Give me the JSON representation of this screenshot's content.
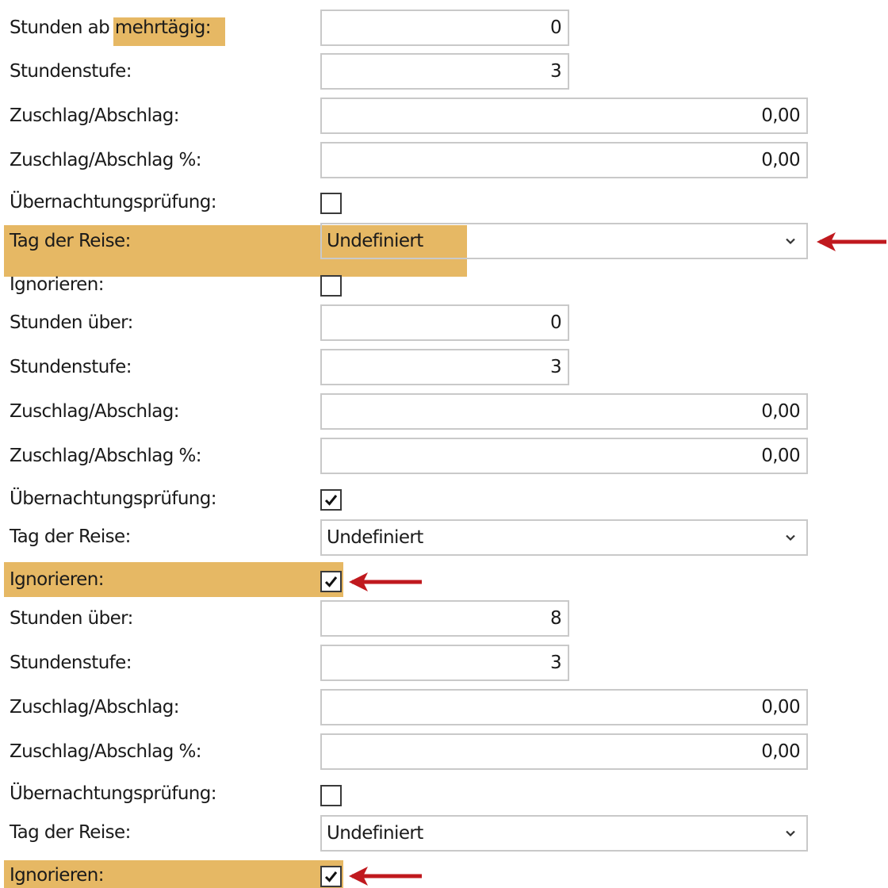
{
  "groups": [
    {
      "first_label_prefix": "Stunden ab",
      "first_label_highlight": "mehrtägig:",
      "first_value": "0",
      "stufe_label": "Stundenstufe:",
      "stufe_value": "3",
      "zuschlag_label": "Zuschlag/Abschlag:",
      "zuschlag_value": "0,00",
      "zuschlag_pct_label": "Zuschlag/Abschlag %:",
      "zuschlag_pct_value": "0,00",
      "uebernachtung_label": "Übernachtungsprüfung:",
      "uebernachtung_checked": false,
      "tag_label": "Tag der Reise:",
      "tag_value": "Undefiniert",
      "ignorieren_label": "Ignorieren:",
      "ignorieren_checked": false
    },
    {
      "first_label": "Stunden über:",
      "first_value": "0",
      "stufe_label": "Stundenstufe:",
      "stufe_value": "3",
      "zuschlag_label": "Zuschlag/Abschlag:",
      "zuschlag_value": "0,00",
      "zuschlag_pct_label": "Zuschlag/Abschlag %:",
      "zuschlag_pct_value": "0,00",
      "uebernachtung_label": "Übernachtungsprüfung:",
      "uebernachtung_checked": true,
      "tag_label": "Tag der Reise:",
      "tag_value": "Undefiniert",
      "ignorieren_label": "Ignorieren:",
      "ignorieren_checked": true
    },
    {
      "first_label": "Stunden über:",
      "first_value": "8",
      "stufe_label": "Stundenstufe:",
      "stufe_value": "3",
      "zuschlag_label": "Zuschlag/Abschlag:",
      "zuschlag_value": "0,00",
      "zuschlag_pct_label": "Zuschlag/Abschlag %:",
      "zuschlag_pct_value": "0,00",
      "uebernachtung_label": "Übernachtungsprüfung:",
      "uebernachtung_checked": false,
      "tag_label": "Tag der Reise:",
      "tag_value": "Undefiniert",
      "ignorieren_label": "Ignorieren:",
      "ignorieren_checked": true
    }
  ],
  "colors": {
    "highlight": "#e6b864",
    "arrow": "#c0191e",
    "border": "#c9c9c9"
  },
  "icons": {
    "dropdown": "chevron-down-icon",
    "check": "checkmark-icon",
    "annotation": "red-arrow-icon"
  }
}
